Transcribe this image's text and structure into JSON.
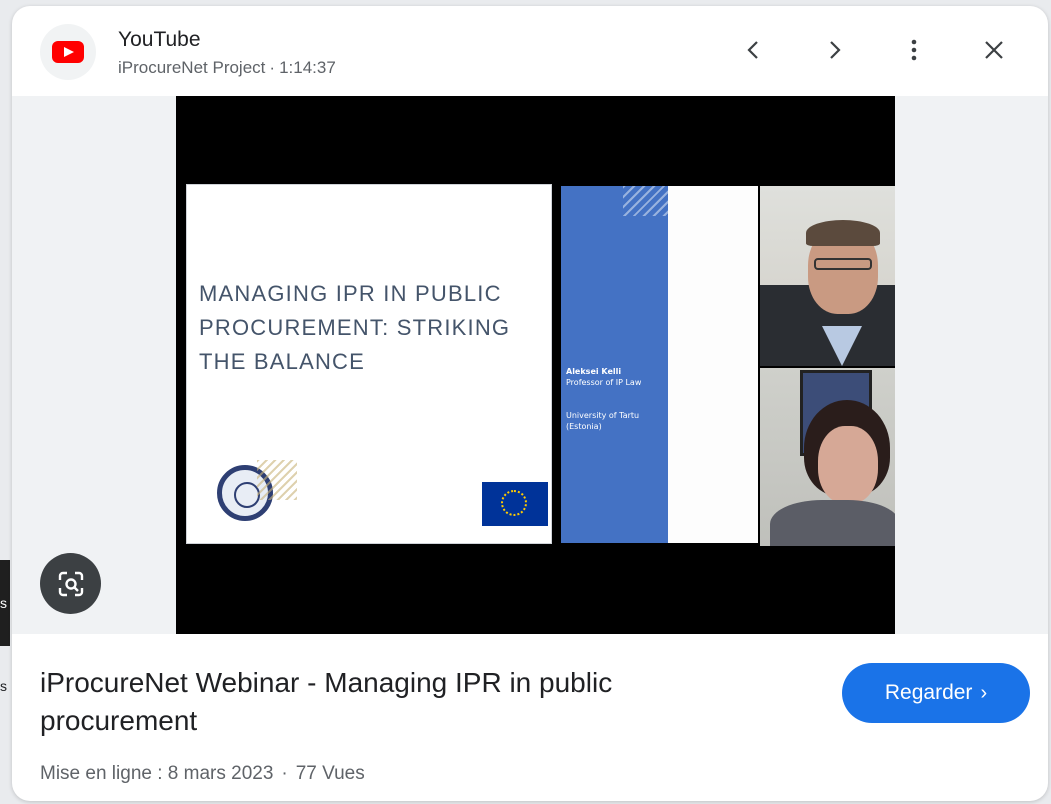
{
  "background": {
    "letters": [
      "s",
      "s"
    ]
  },
  "header": {
    "site_name": "YouTube",
    "channel": "iProcureNet Project",
    "separator": "·",
    "duration": "1:14:37",
    "prev_icon": "chevron-left-icon",
    "next_icon": "chevron-right-icon",
    "more_icon": "more-vert-icon",
    "close_icon": "close-icon"
  },
  "video": {
    "slide_title": "MANAGING IPR IN PUBLIC\nPROCUREMENT: STRIKING\nTHE BALANCE",
    "speaker_name": "Aleksei Kelli",
    "speaker_role": "Professor of IP Law",
    "speaker_org": "University of Tartu (Estonia)"
  },
  "lens_icon": "lens-search-icon",
  "result": {
    "title": "iProcureNet Webinar - Managing IPR in public procurement",
    "watch_label": "Regarder",
    "watch_chevron": "›",
    "upload_label": "Mise en ligne : 8 mars 2023",
    "dot": "·",
    "views": "77 Vues"
  },
  "colors": {
    "accent": "#1a73e8",
    "youtube_red": "#ff0000",
    "slide_blue": "#4472c4"
  }
}
